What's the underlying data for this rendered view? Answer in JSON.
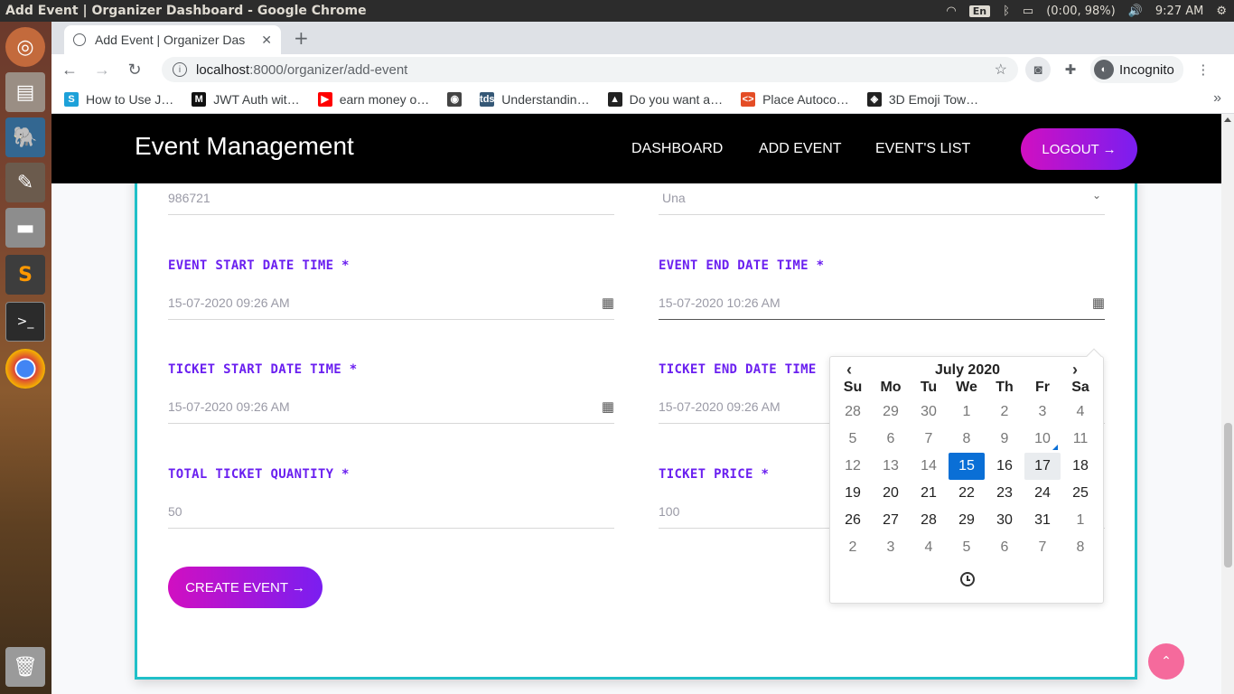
{
  "os": {
    "window_title": "Add Event | Organizer Dashboard - Google Chrome",
    "lang": "En",
    "battery": "(0:00, 98%)",
    "time": "9:27 AM"
  },
  "browser": {
    "tab_title": "Add Event | Organizer Das",
    "url_host": "localhost",
    "url_path": ":8000/organizer/add-event",
    "profile_label": "Incognito",
    "bookmarks": [
      {
        "label": "How to Use J…",
        "icon": "S",
        "color": "#1da1d9"
      },
      {
        "label": "JWT Auth wit…",
        "icon": "M",
        "color": "#111111"
      },
      {
        "label": "earn money o…",
        "icon": "▶",
        "color": "#ff0000"
      },
      {
        "label": "",
        "icon": "◉",
        "color": "#444444"
      },
      {
        "label": "Understandin…",
        "icon": "tds",
        "color": "#355876"
      },
      {
        "label": "Do you want a…",
        "icon": "▲",
        "color": "#222222"
      },
      {
        "label": "Place Autoco…",
        "icon": "<>",
        "color": "#e44d26"
      },
      {
        "label": "3D Emoji Tow…",
        "icon": "◈",
        "color": "#222222"
      }
    ]
  },
  "site": {
    "brand": "Event Management",
    "nav": {
      "dashboard": "DASHBOARD",
      "add_event": "ADD EVENT",
      "events_list": "EVENT'S LIST"
    },
    "logout_label": "LOGOUT →"
  },
  "form": {
    "pincode_value": "986721",
    "city_value": "Una",
    "event_start": {
      "label": "EVENT START DATE TIME *",
      "value": "15-07-2020 09:26 AM"
    },
    "event_end": {
      "label": "EVENT END DATE TIME *",
      "value": "15-07-2020 10:26 AM"
    },
    "ticket_start": {
      "label": "TICKET START DATE TIME *",
      "value": "15-07-2020 09:26 AM"
    },
    "ticket_end": {
      "label": "TICKET END DATE TIME",
      "value": "15-07-2020 09:26 AM"
    },
    "total_ticket": {
      "label": "TOTAL TICKET QUANTITY *",
      "value": "50"
    },
    "ticket_price": {
      "label": "TICKET PRICE *",
      "value": "100"
    },
    "submit_label": "CREATE EVENT →"
  },
  "datepicker": {
    "title": "July 2020",
    "weekdays": [
      "Su",
      "Mo",
      "Tu",
      "We",
      "Th",
      "Fr",
      "Sa"
    ],
    "weeks": [
      [
        "28",
        "29",
        "30",
        "1",
        "2",
        "3",
        "4"
      ],
      [
        "5",
        "6",
        "7",
        "8",
        "9",
        "10",
        "11"
      ],
      [
        "12",
        "13",
        "14",
        "15",
        "16",
        "17",
        "18"
      ],
      [
        "19",
        "20",
        "21",
        "22",
        "23",
        "24",
        "25"
      ],
      [
        "26",
        "27",
        "28",
        "29",
        "30",
        "31",
        "1"
      ],
      [
        "2",
        "3",
        "4",
        "5",
        "6",
        "7",
        "8"
      ]
    ],
    "selected_day": "15",
    "today_day": "17"
  }
}
